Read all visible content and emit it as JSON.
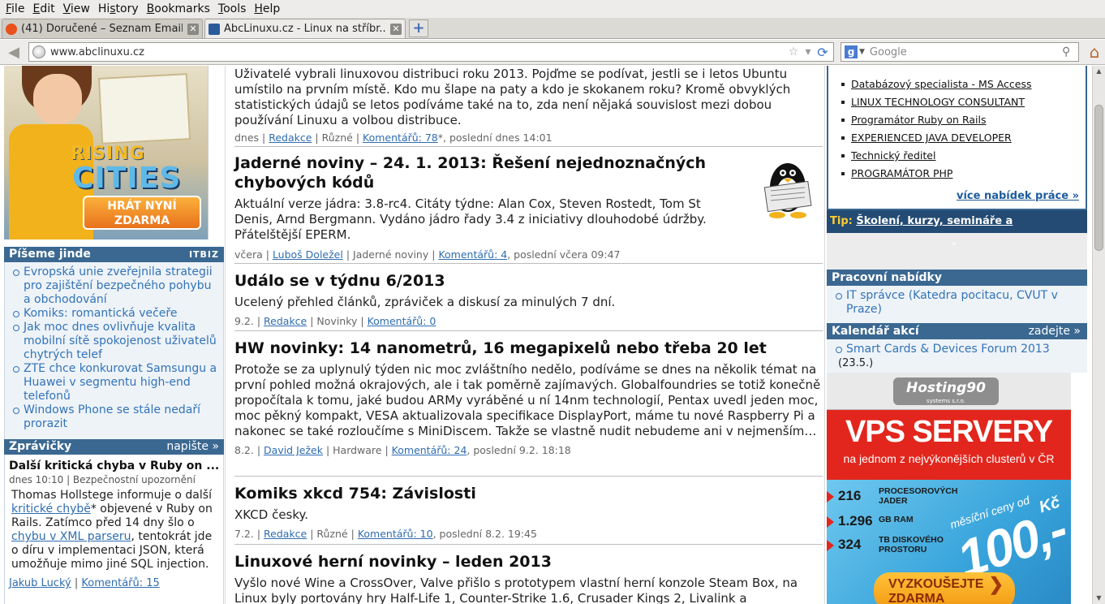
{
  "menu": [
    "File",
    "Edit",
    "View",
    "History",
    "Bookmarks",
    "Tools",
    "Help"
  ],
  "menu_underline": [
    "F",
    "E",
    "V",
    "s",
    "B",
    "T",
    "H"
  ],
  "tabs": [
    {
      "title": "(41) Doručené – Seznam Email",
      "active": false,
      "favicon": "seznam-icon"
    },
    {
      "title": "AbcLinuxu.cz - Linux na stříbr...",
      "active": true,
      "favicon": "abclinuxu-icon"
    }
  ],
  "address": {
    "url": "www.abclinuxu.cz"
  },
  "search": {
    "engine": "Google",
    "placeholder": "Google"
  },
  "left": {
    "ad": {
      "title1": "RISING",
      "title2": "CITIES",
      "button_line1": "HRÁT NYNÍ",
      "button_line2": "ZDARMA"
    },
    "piseme": {
      "title": "Píšeme jinde",
      "brand": "ITBIZ",
      "items": [
        "Evropská unie zveřejnila strategii pro zajištění bezpečného pohybu a obchodování",
        "Komiks: romantická večeře",
        "Jak moc dnes ovlivňuje kvalita mobilní sítě spokojenost uživatelů chytrých telef",
        "ZTE chce konkurovat Samsungu a Huawei v segmentu high-end telefonů",
        "Windows Phone se stále nedaří prorazit"
      ]
    },
    "zpravicky": {
      "title": "Zprávičky",
      "action": "napište »",
      "item": {
        "title": "Další kritická chyba v Ruby on ...",
        "meta": "dnes 10:10 | Bezpečnostní upozornění",
        "text1": "Thomas Hollstege informuje o další ",
        "link1": "kritické chybě",
        "text2": "* objevené v Ruby on Rails. Zatímco před 14 dny šlo o ",
        "link2": "chybu v XML parseru",
        "text3": ", tentokrát jde o díru v implementaci JSON, která umožňuje mimo jiné SQL injection.",
        "author": "Jakub Lucký",
        "comments": "Komentářů: 15"
      }
    }
  },
  "articles": [
    {
      "title": "",
      "text": "Uživatelé vybrali linuxovou distribuci roku 2013. Pojďme se podívat, jestli se i letos Ubuntu umístilo na prvním místě. Kdo mu šlape na paty a kdo je skokanem roku? Kromě obvyklých statistických údajů se letos podíváme také na to, zda není nějaká souvislost mezi dobou používání Linuxu a volbou distribuce.",
      "date": "dnes",
      "author": "Redakce",
      "section": "Různé",
      "comments": "Komentářů: 78",
      "last": "*, poslední dnes 14:01"
    },
    {
      "title": "Jaderné noviny – 24. 1. 2013: Řešení nejednoznačných chybových kódů",
      "text": "Aktuální verze jádra: 3.8-rc4. Citáty týdne: Alan Cox, Steven Rostedt, Tom St Denis, Arnd Bergmann. Vydáno jádro řady 3.4 z iniciativy dlouhodobé údržby. Přátelštější EPERM.",
      "date": "včera",
      "author": "Luboš Doležel",
      "section": "Jaderné noviny",
      "comments": "Komentářů: 4",
      "last": ", poslední včera 09:47"
    },
    {
      "title": "Událo se v týdnu 6/2013",
      "text": "Ucelený přehled článků, zpráviček a diskusí za minulých 7 dní.",
      "date": "9.2.",
      "author": "Redakce",
      "section": "Novinky",
      "comments": "Komentářů: 0",
      "last": ""
    },
    {
      "title": "HW novinky: 14 nanometrů, 16 megapixelů nebo třeba 20 let",
      "text": "Protože se za uplynulý týden nic moc zvláštního nedělo, podíváme se dnes na několik témat na první pohled možná okrajových, ale i tak poměrně zajímavých. Globalfoundries se totiž konečně propočítala k tomu, jaké budou ARMy vyráběné u ní 14nm technologií, Pentax uvedl jeden moc, moc pěkný kompakt, VESA aktualizovala specifikace DisplayPort, máme tu nové Raspberry Pi a nakonec se také rozloučíme s MiniDiscem. Takže se vlastně nudit nebudeme ani v nejmenším…",
      "date": "8.2.",
      "author": "David Ježek",
      "section": "Hardware",
      "comments": "Komentářů: 24",
      "last": ", poslední 9.2. 18:18"
    },
    {
      "title": "Komiks xkcd 754: Závislosti",
      "text": "XKCD česky.",
      "date": "7.2.",
      "author": "Redakce",
      "section": "Různé",
      "comments": "Komentářů: 10",
      "last": ", poslední 8.2. 19:45"
    },
    {
      "title": "Linuxové herní novinky – leden 2013",
      "text": "Vyšlo nové Wine a CrossOver, Valve přišlo s prototypem vlastní herní konzole Steam Box, na Linux byly portovány hry Half-Life 1, Counter-Strike 1.6, Crusader Kings 2, Livalink a",
      "date": "",
      "author": "",
      "section": "",
      "comments": "",
      "last": ""
    }
  ],
  "right": {
    "jobs": [
      "Databázový specialista - MS Access",
      "LINUX TECHNOLOGY CONSULTANT",
      "Programátor Ruby on Rails",
      "EXPERIENCED JAVA DEVELOPER",
      "Technický ředitel",
      "PROGRAMÁTOR PHP"
    ],
    "more_jobs": "více nabídek práce »",
    "tip_label": "Tip:",
    "tip_text": "Školení, kurzy, semináře a rekvalifikace",
    "pracovni": {
      "title": "Pracovní nabídky",
      "items": [
        "IT správce (Katedra pocitacu, CVUT v Praze)"
      ]
    },
    "kalendar": {
      "title": "Kalendář akcí",
      "action": "zadejte »",
      "items": [
        "Smart Cards & Devices Forum 2013"
      ],
      "date": "(23.5.)"
    },
    "vps": {
      "logo": "Hosting90",
      "logo_sub": "systems s.r.o.",
      "headline": "VPS SERVERY",
      "subline": "na jednom z nejvýkonějších clusterů v ČR",
      "specs": [
        {
          "n": "216",
          "t": "PROCESOROVÝCH JADER"
        },
        {
          "n": "1.296",
          "t": "GB RAM"
        },
        {
          "n": "324",
          "t": "TB DISKOVÉHO PROSTORU"
        }
      ],
      "price_label": "měsíční ceny od",
      "price": "100,-",
      "currency": "Kč",
      "cta_line1": "VYZKOUŠEJTE",
      "cta_line2": "ZDARMA"
    }
  }
}
